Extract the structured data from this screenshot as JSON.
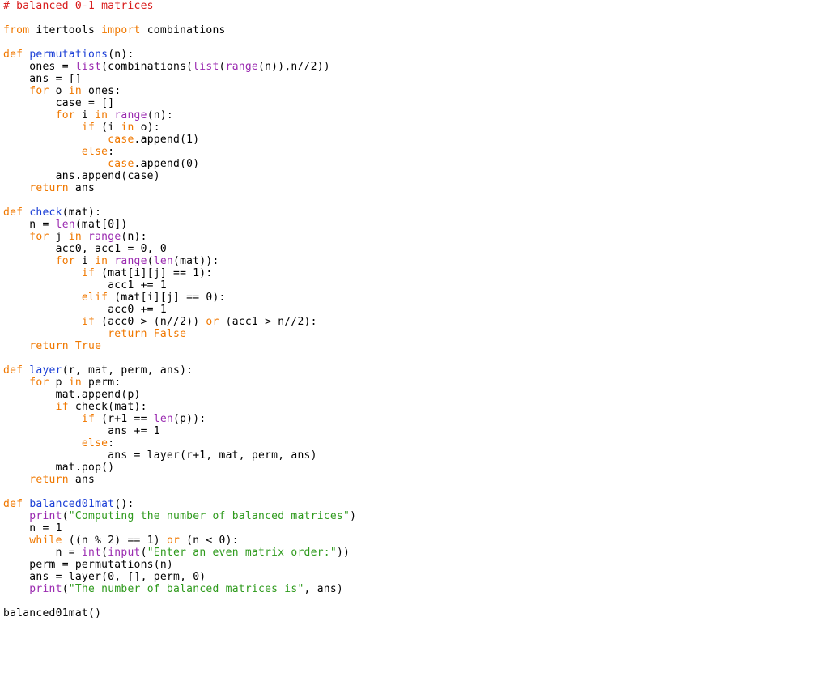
{
  "colors": {
    "comment": "#d81b1b",
    "keyword": "#f07800",
    "builtin": "#9a2ab0",
    "function": "#1a3ed6",
    "string": "#2e9a1c",
    "plain": "#000000",
    "background": "#ffffff"
  },
  "code": {
    "lines": [
      [
        [
          "c",
          "# balanced 0-1 matrices"
        ]
      ],
      [],
      [
        [
          "k",
          "from"
        ],
        [
          "p",
          " itertools "
        ],
        [
          "k",
          "import"
        ],
        [
          "p",
          " combinations"
        ]
      ],
      [],
      [
        [
          "k",
          "def"
        ],
        [
          "p",
          " "
        ],
        [
          "f",
          "permutations"
        ],
        [
          "p",
          "(n):"
        ]
      ],
      [
        [
          "p",
          "    ones = "
        ],
        [
          "b",
          "list"
        ],
        [
          "p",
          "(combinations("
        ],
        [
          "b",
          "list"
        ],
        [
          "p",
          "("
        ],
        [
          "b",
          "range"
        ],
        [
          "p",
          "(n)),n//2))"
        ]
      ],
      [
        [
          "p",
          "    ans = []"
        ]
      ],
      [
        [
          "k",
          "    for"
        ],
        [
          "p",
          " o "
        ],
        [
          "k",
          "in"
        ],
        [
          "p",
          " ones:"
        ]
      ],
      [
        [
          "p",
          "        case = []"
        ]
      ],
      [
        [
          "k",
          "        for"
        ],
        [
          "p",
          " i "
        ],
        [
          "k",
          "in"
        ],
        [
          "p",
          " "
        ],
        [
          "b",
          "range"
        ],
        [
          "p",
          "(n):"
        ]
      ],
      [
        [
          "k",
          "            if"
        ],
        [
          "p",
          " (i "
        ],
        [
          "k",
          "in"
        ],
        [
          "p",
          " o):"
        ]
      ],
      [
        [
          "k",
          "                case"
        ],
        [
          "p",
          ".append(1)"
        ]
      ],
      [
        [
          "k",
          "            else"
        ],
        [
          "p",
          ":"
        ]
      ],
      [
        [
          "k",
          "                case"
        ],
        [
          "p",
          ".append(0)"
        ]
      ],
      [
        [
          "p",
          "        ans.append(case)"
        ]
      ],
      [
        [
          "k",
          "    return"
        ],
        [
          "p",
          " ans"
        ]
      ],
      [],
      [
        [
          "k",
          "def"
        ],
        [
          "p",
          " "
        ],
        [
          "f",
          "check"
        ],
        [
          "p",
          "(mat):"
        ]
      ],
      [
        [
          "p",
          "    n = "
        ],
        [
          "b",
          "len"
        ],
        [
          "p",
          "(mat[0])"
        ]
      ],
      [
        [
          "k",
          "    for"
        ],
        [
          "p",
          " j "
        ],
        [
          "k",
          "in"
        ],
        [
          "p",
          " "
        ],
        [
          "b",
          "range"
        ],
        [
          "p",
          "(n):"
        ]
      ],
      [
        [
          "p",
          "        acc0, acc1 = 0, 0"
        ]
      ],
      [
        [
          "k",
          "        for"
        ],
        [
          "p",
          " i "
        ],
        [
          "k",
          "in"
        ],
        [
          "p",
          " "
        ],
        [
          "b",
          "range"
        ],
        [
          "p",
          "("
        ],
        [
          "b",
          "len"
        ],
        [
          "p",
          "(mat)):"
        ]
      ],
      [
        [
          "k",
          "            if"
        ],
        [
          "p",
          " (mat[i][j] == 1):"
        ]
      ],
      [
        [
          "p",
          "                acc1 += 1"
        ]
      ],
      [
        [
          "k",
          "            elif"
        ],
        [
          "p",
          " (mat[i][j] == 0):"
        ]
      ],
      [
        [
          "p",
          "                acc0 += 1"
        ]
      ],
      [
        [
          "k",
          "            if"
        ],
        [
          "p",
          " (acc0 > (n//2)) "
        ],
        [
          "k",
          "or"
        ],
        [
          "p",
          " (acc1 > n//2):"
        ]
      ],
      [
        [
          "k",
          "                return"
        ],
        [
          "p",
          " "
        ],
        [
          "k",
          "False"
        ]
      ],
      [
        [
          "k",
          "    return"
        ],
        [
          "p",
          " "
        ],
        [
          "k",
          "True"
        ]
      ],
      [],
      [
        [
          "k",
          "def"
        ],
        [
          "p",
          " "
        ],
        [
          "f",
          "layer"
        ],
        [
          "p",
          "(r, mat, perm, ans):"
        ]
      ],
      [
        [
          "k",
          "    for"
        ],
        [
          "p",
          " p "
        ],
        [
          "k",
          "in"
        ],
        [
          "p",
          " perm:"
        ]
      ],
      [
        [
          "p",
          "        mat.append(p)"
        ]
      ],
      [
        [
          "k",
          "        if"
        ],
        [
          "p",
          " check(mat):"
        ]
      ],
      [
        [
          "k",
          "            if"
        ],
        [
          "p",
          " (r+1 == "
        ],
        [
          "b",
          "len"
        ],
        [
          "p",
          "(p)):"
        ]
      ],
      [
        [
          "p",
          "                ans += 1"
        ]
      ],
      [
        [
          "k",
          "            else"
        ],
        [
          "p",
          ":"
        ]
      ],
      [
        [
          "p",
          "                ans = layer(r+1, mat, perm, ans)"
        ]
      ],
      [
        [
          "p",
          "        mat.pop()"
        ]
      ],
      [
        [
          "k",
          "    return"
        ],
        [
          "p",
          " ans"
        ]
      ],
      [],
      [
        [
          "k",
          "def"
        ],
        [
          "p",
          " "
        ],
        [
          "f",
          "balanced01mat"
        ],
        [
          "p",
          "():"
        ]
      ],
      [
        [
          "b",
          "    print"
        ],
        [
          "p",
          "("
        ],
        [
          "s",
          "\"Computing the number of balanced matrices\""
        ],
        [
          "p",
          ")"
        ]
      ],
      [
        [
          "p",
          "    n = 1"
        ]
      ],
      [
        [
          "k",
          "    while"
        ],
        [
          "p",
          " ((n % 2) == 1) "
        ],
        [
          "k",
          "or"
        ],
        [
          "p",
          " (n < 0):"
        ]
      ],
      [
        [
          "p",
          "        n = "
        ],
        [
          "b",
          "int"
        ],
        [
          "p",
          "("
        ],
        [
          "b",
          "input"
        ],
        [
          "p",
          "("
        ],
        [
          "s",
          "\"Enter an even matrix order:\""
        ],
        [
          "p",
          "))"
        ]
      ],
      [
        [
          "p",
          "    perm = permutations(n)"
        ]
      ],
      [
        [
          "p",
          "    ans = layer(0, [], perm, 0)"
        ]
      ],
      [
        [
          "b",
          "    print"
        ],
        [
          "p",
          "("
        ],
        [
          "s",
          "\"The number of balanced matrices is\""
        ],
        [
          "p",
          ", ans)"
        ]
      ],
      [],
      [
        [
          "p",
          "balanced01mat()"
        ]
      ]
    ]
  }
}
